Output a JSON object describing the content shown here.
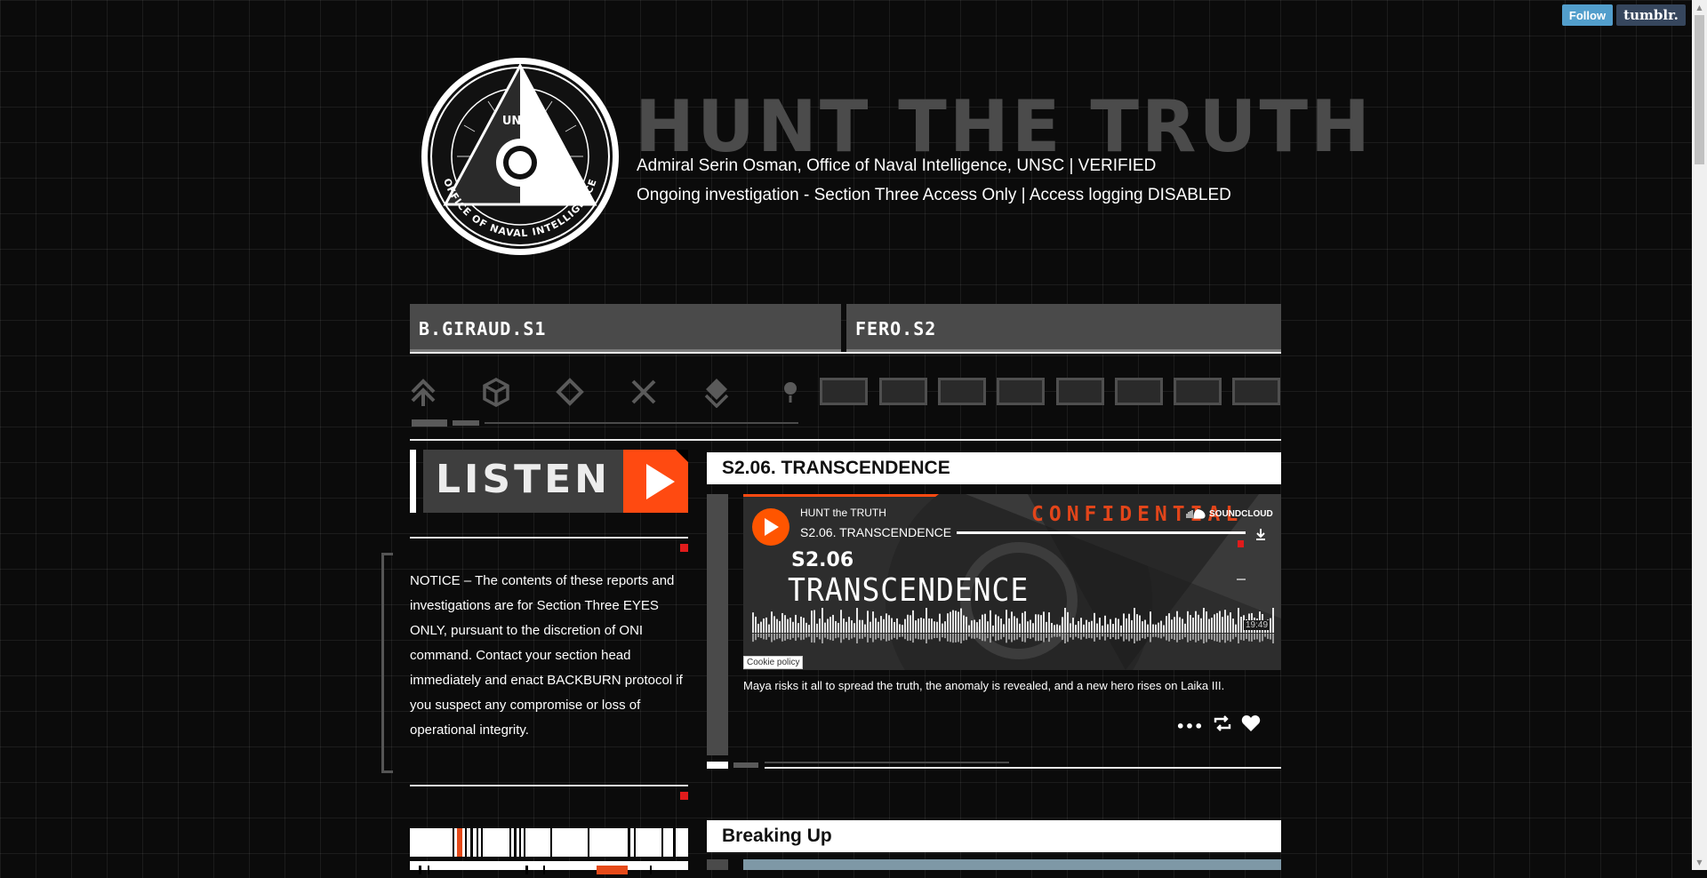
{
  "tumblr": {
    "follow_label": "Follow",
    "logo_text": "tumblr."
  },
  "header": {
    "seal_top_text": "UNSC",
    "seal_ring_text": "OFFICE OF NAVAL INTELLIGENCE",
    "title": "HUNT THE TRUTH",
    "subtitle_line1": "Admiral Serin Osman, Office of Naval Intelligence, UNSC | VERIFIED",
    "subtitle_line2": "Ongoing investigation - Section Three Access Only | Access logging DISABLED"
  },
  "tabs": [
    {
      "label": "B.GIRAUD.S1"
    },
    {
      "label": "FERO.S2"
    }
  ],
  "nav_icons": [
    "chevrons-up-icon",
    "cube-icon",
    "diamond-icon",
    "x-icon",
    "layers-icon",
    "dot-icon"
  ],
  "listen": {
    "label": "LISTEN"
  },
  "notice": {
    "text": "NOTICE – The contents of these reports and investigations are for Section Three EYES ONLY, pursuant to the discretion of ONI command. Contact your section head immediately and enact BACKBURN protocol if you suspect any compromise or loss of operational integrity."
  },
  "posts": [
    {
      "title": "S2.06. TRANSCENDENCE",
      "player": {
        "artist": "HUNT the TRUTH",
        "track": "S2.06. TRANSCENDENCE",
        "brand": "SOUNDCLOUD",
        "art_stamp": "CONFIDENTIAL",
        "art_code": "S2.06",
        "art_title": "TRANSCENDENCE",
        "duration": "19:49",
        "cookie_label": "Cookie policy",
        "progress": 0.985
      },
      "description": "Maya risks it all to spread the truth, the anomaly is revealed, and a new hero rises on Laika III."
    },
    {
      "title": "Breaking Up"
    }
  ],
  "colors": {
    "accent": "#ff4a11",
    "red": "#e01b1b",
    "tab_bg": "#4a4a4a",
    "title_gray": "#4b4b4b"
  }
}
